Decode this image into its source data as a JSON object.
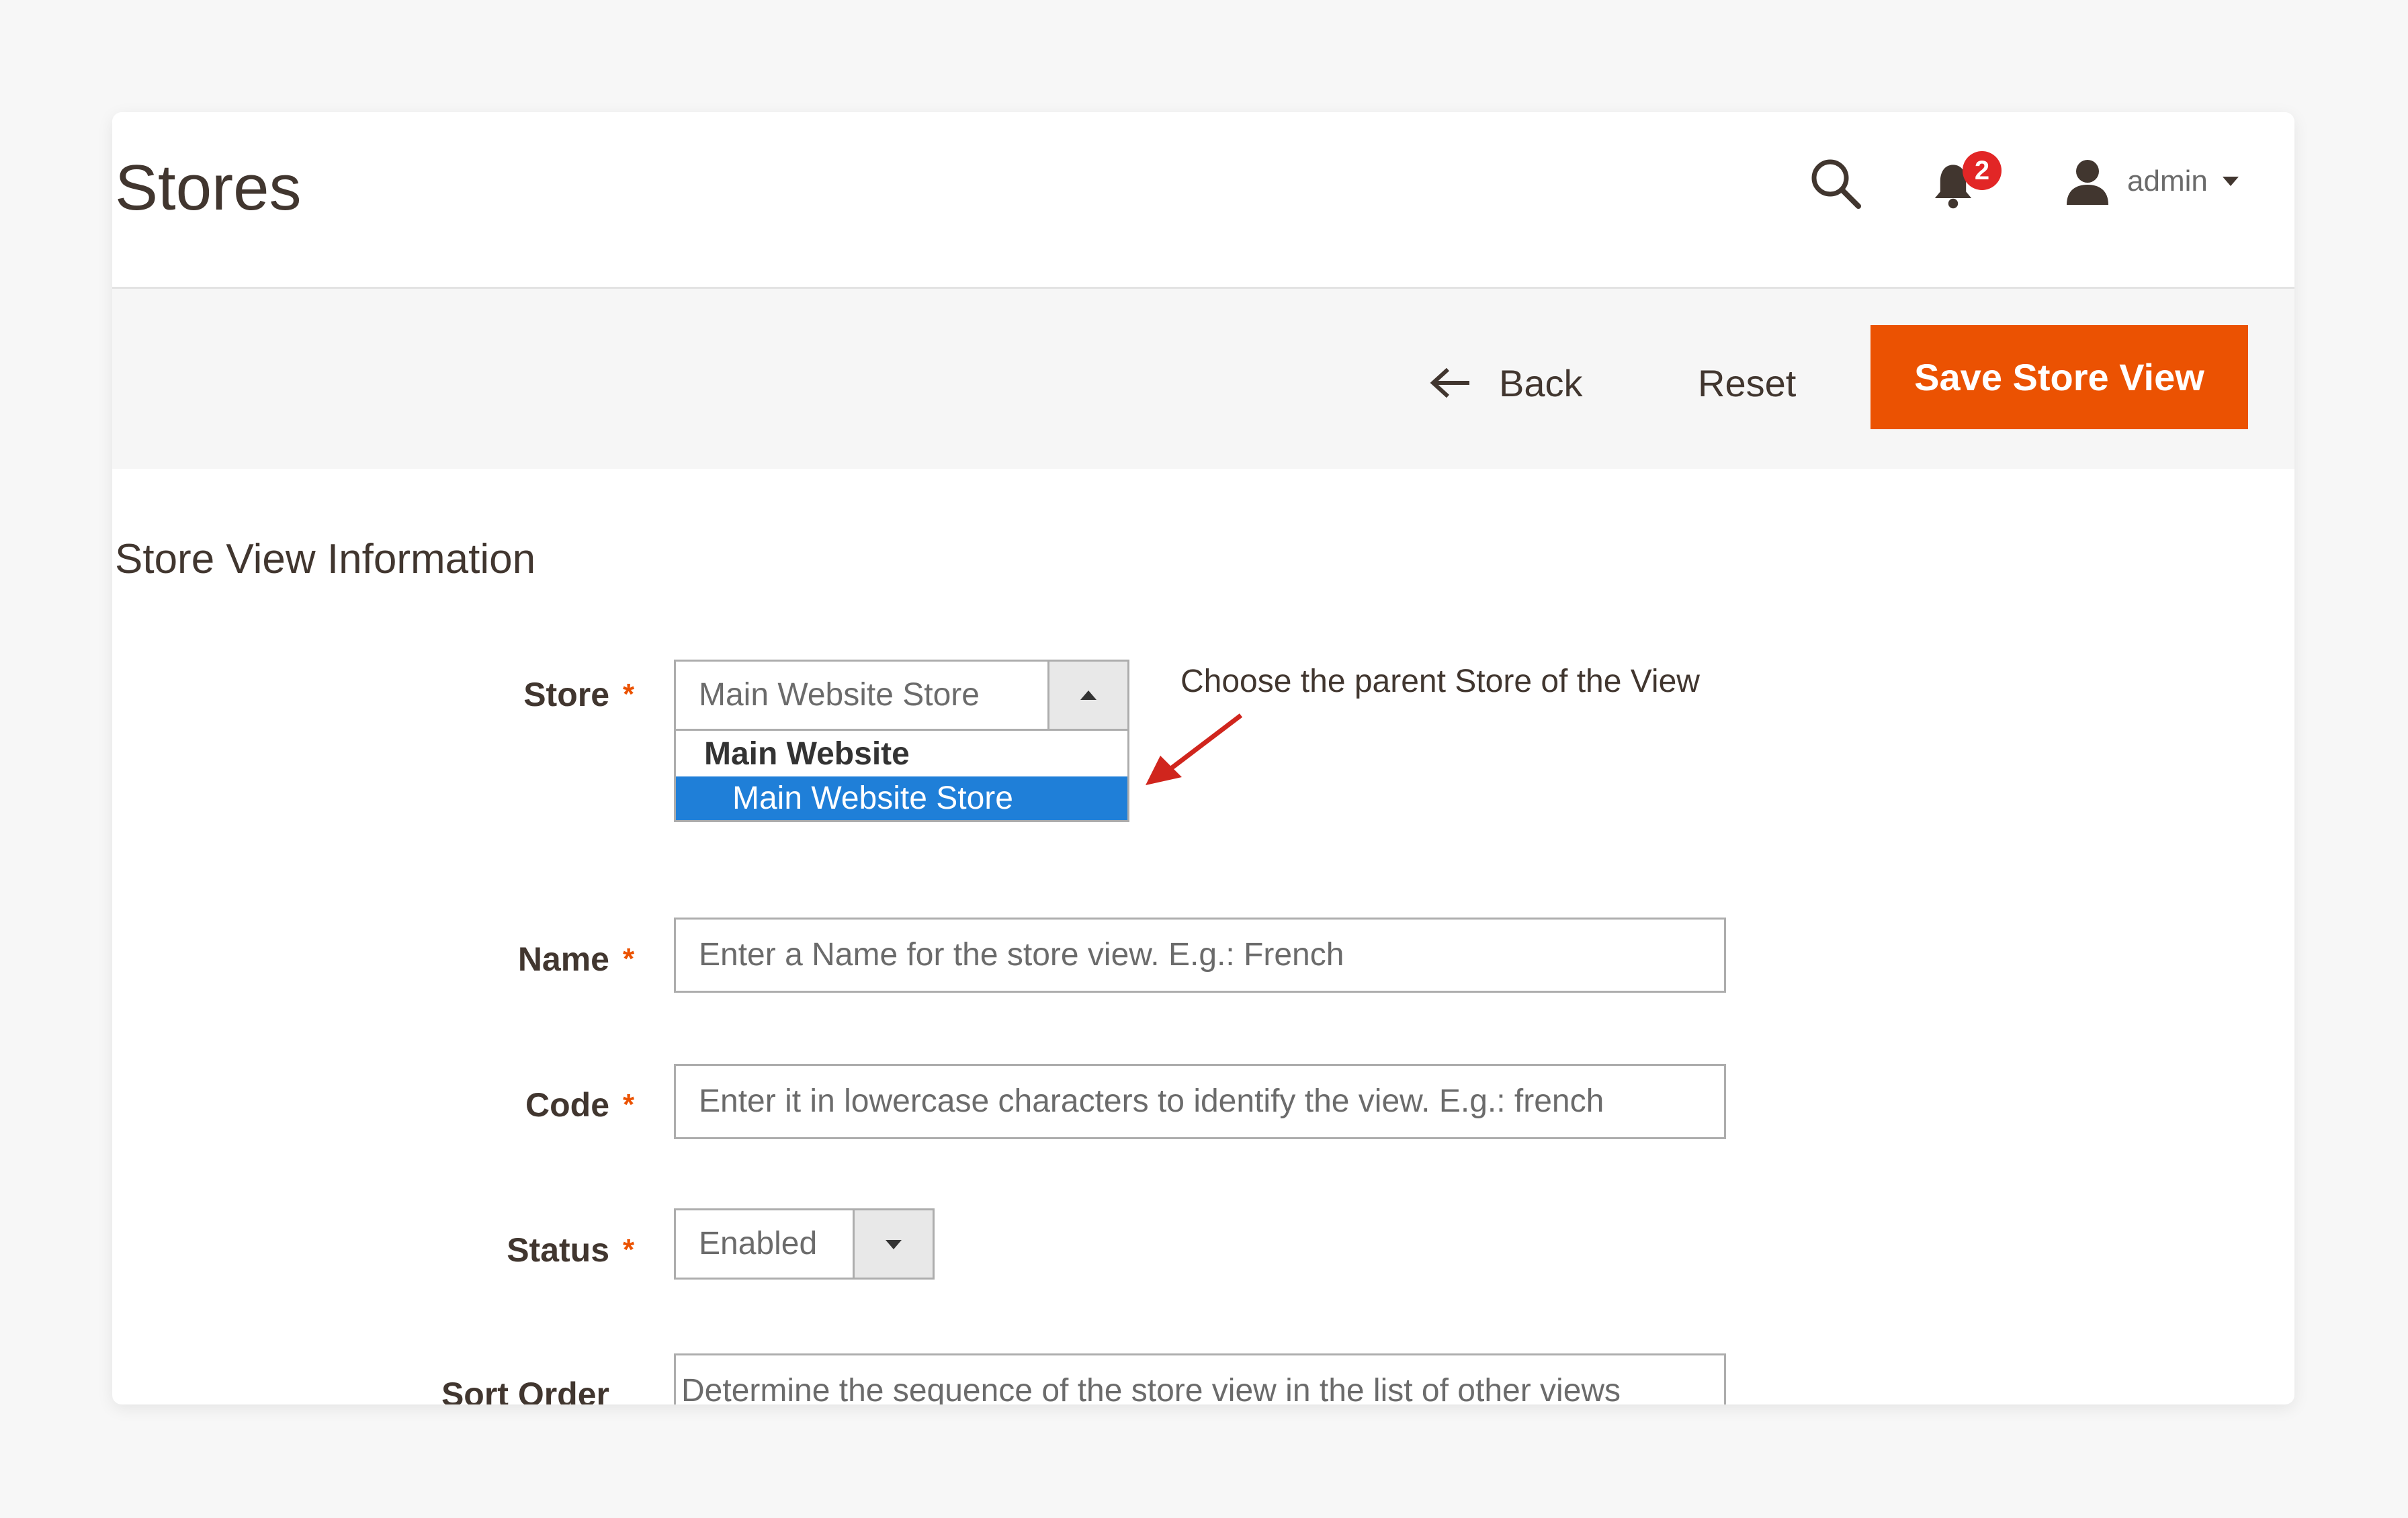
{
  "header": {
    "title": "Stores",
    "notifications_count": "2",
    "user_name": "admin"
  },
  "toolbar": {
    "back_label": "Back",
    "reset_label": "Reset",
    "save_label": "Save Store View"
  },
  "section": {
    "title": "Store View Information"
  },
  "form": {
    "store": {
      "label": "Store",
      "value": "Main Website Store",
      "options_group": "Main Website",
      "selected_option": "Main Website Store",
      "annotation": "Choose the parent Store of the View"
    },
    "name": {
      "label": "Name",
      "text": "Enter a Name for the store view. E.g.: French"
    },
    "code": {
      "label": "Code",
      "text": "Enter it in lowercase characters to identify the view. E.g.: french"
    },
    "status": {
      "label": "Status",
      "value": "Enabled"
    },
    "sort_order": {
      "label": "Sort Order",
      "text": "Determine the sequence of the store view in the list of other views"
    },
    "required_mark": "*"
  },
  "colors": {
    "accent": "#eb5202",
    "selection": "#1f7fd8",
    "badge": "#e22626"
  }
}
